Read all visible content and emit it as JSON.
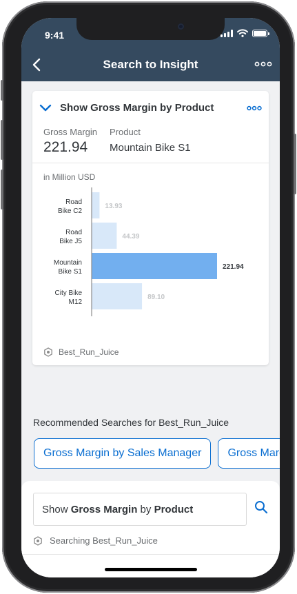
{
  "status_bar": {
    "time": "9:41"
  },
  "header": {
    "title": "Search to Insight",
    "back_icon": "chevron-left-icon",
    "more_icon": "ellipsis-icon"
  },
  "card": {
    "title": "Show Gross Margin by Product",
    "kpi_label_1": "Gross Margin",
    "kpi_value_1": "221.94",
    "kpi_label_2": "Product",
    "kpi_value_2": "Mountain Bike S1",
    "unit": "in Million USD",
    "footer_source": "Best_Run_Juice",
    "colors": {
      "bar": "#d8e8f9",
      "bar_selected": "#72afef",
      "axis": "#8c8c8c"
    }
  },
  "chart_data": {
    "type": "bar",
    "orientation": "horizontal",
    "categories": [
      [
        "Road",
        "Bike C2"
      ],
      [
        "Road",
        "Bike J5"
      ],
      [
        "Mountain",
        "Bike S1"
      ],
      [
        "City Bike",
        "M12"
      ]
    ],
    "values": [
      13.93,
      44.39,
      221.94,
      89.1
    ],
    "value_labels": [
      "13.93",
      "44.39",
      "221.94",
      "89.10"
    ],
    "selected_index": 2,
    "title": "",
    "xlabel": "",
    "ylabel": "",
    "unit": "in Million USD"
  },
  "recommended": {
    "title": "Recommended Searches for Best_Run_Juice",
    "chips": [
      "Gross Margin by Sales Manager",
      "Gross Margin"
    ]
  },
  "search": {
    "prefix": "Show ",
    "measure": "Gross Margin",
    "connector": " by ",
    "dimension": "Product",
    "status": "Searching Best_Run_Juice"
  }
}
